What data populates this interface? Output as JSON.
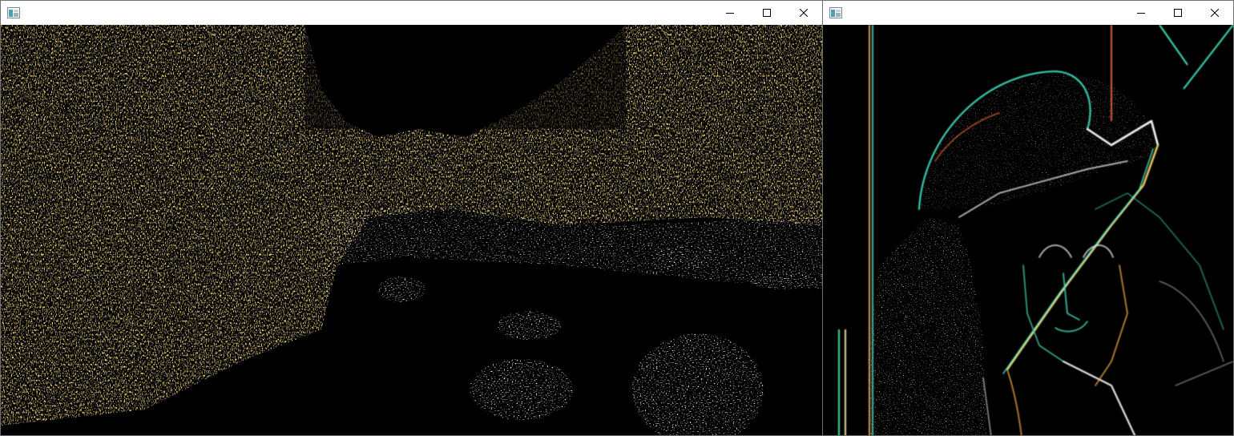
{
  "windows": [
    {
      "title": "",
      "controls": {
        "minimize_icon": "minimize-icon",
        "maximize_icon": "maximize-icon",
        "close_icon": "close-icon"
      },
      "content": {
        "description": "",
        "accent_colors": [
          "#e0a020",
          "#f0f0f0",
          "#3050c0"
        ]
      }
    },
    {
      "title": "",
      "controls": {
        "minimize_icon": "minimize-icon",
        "maximize_icon": "maximize-icon",
        "close_icon": "close-icon"
      },
      "content": {
        "description": "",
        "accent_colors": [
          "#40e0c0",
          "#f0d080",
          "#ffffff",
          "#e08040"
        ]
      }
    }
  ]
}
